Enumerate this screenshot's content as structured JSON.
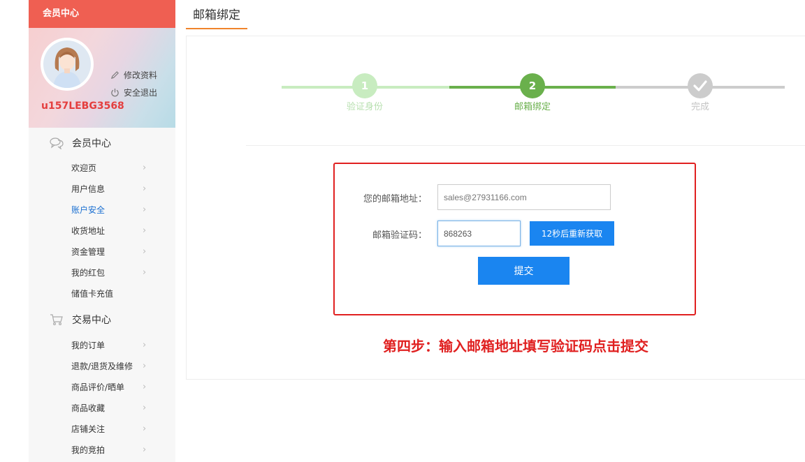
{
  "sidebar": {
    "header": "会员中心",
    "profile": {
      "edit_label": "修改资料",
      "logout_label": "安全退出",
      "username": "u157LEBG3568"
    },
    "sections": [
      {
        "title": "会员中心",
        "icon": "chat-bubbles-icon",
        "items": [
          {
            "label": "欢迎页",
            "chevron": true
          },
          {
            "label": "用户信息",
            "chevron": true
          },
          {
            "label": "账户安全",
            "chevron": true,
            "active": true
          },
          {
            "label": "收货地址",
            "chevron": true
          },
          {
            "label": "资金管理",
            "chevron": true
          },
          {
            "label": "我的红包",
            "chevron": true
          },
          {
            "label": "储值卡充值",
            "chevron": false
          }
        ]
      },
      {
        "title": "交易中心",
        "icon": "shopping-cart-icon",
        "items": [
          {
            "label": "我的订单",
            "chevron": true
          },
          {
            "label": "退款/退货及维修",
            "chevron": true
          },
          {
            "label": "商品评价/晒单",
            "chevron": true
          },
          {
            "label": "商品收藏",
            "chevron": true
          },
          {
            "label": "店铺关注",
            "chevron": true
          },
          {
            "label": "我的竞拍",
            "chevron": true
          }
        ]
      }
    ]
  },
  "main": {
    "tab_title": "邮箱绑定",
    "steps": [
      {
        "number": "1",
        "label": "验证身份",
        "state": "done"
      },
      {
        "number": "2",
        "label": "邮箱绑定",
        "state": "current"
      },
      {
        "number": "",
        "label": "完成",
        "state": "pending",
        "icon": "checkmark-icon"
      }
    ],
    "form": {
      "email_label": "您的邮箱地址：",
      "email_value": "sales@27931166.com",
      "code_label": "邮箱验证码：",
      "code_value": "868263",
      "resend_button": "12秒后重新获取",
      "submit_button": "提交"
    },
    "hint": "第四步：输入邮箱地址填写验证码点击提交"
  },
  "colors": {
    "header_red": "#ef5f52",
    "username_red": "#e43e3e",
    "active_link": "#1a6fd1",
    "step_done": "#c8ecc0",
    "step_current": "#6ab04c",
    "step_pending": "#cccccc",
    "tab_underline": "#f0842b",
    "button_blue": "#1a85f0",
    "highlight_red": "#e02020"
  }
}
